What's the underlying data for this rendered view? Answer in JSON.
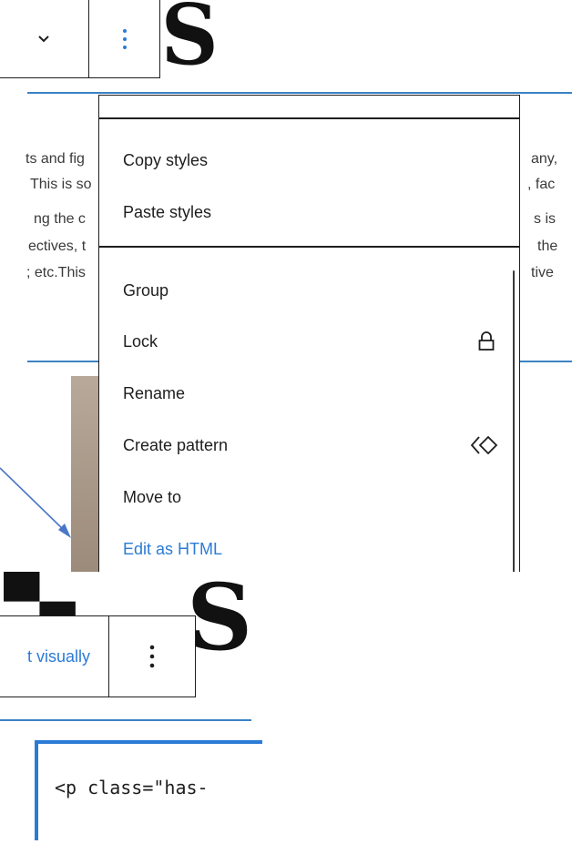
{
  "top": {
    "heading_glyph": "S",
    "paragraph_fragments": [
      {
        "left": "ts and fig",
        "right": "any,"
      },
      {
        "left": "This is so",
        "right": ", fac"
      },
      {
        "left": "ng the c",
        "right": "s is"
      },
      {
        "left": "ectives, t",
        "right": "the"
      },
      {
        "left": "; etc.This",
        "right": "tive"
      }
    ],
    "block_toolbar": {
      "chevron_icon": "chevron-down-icon",
      "more_icon": "more-vertical-icon"
    }
  },
  "menu": {
    "items": [
      {
        "label": "Copy styles"
      },
      {
        "label": "Paste styles"
      },
      {
        "label": "Group"
      },
      {
        "label": "Lock",
        "icon": "lock-icon"
      },
      {
        "label": "Rename"
      },
      {
        "label": "Create pattern",
        "icon": "symbol-diamond-icon"
      },
      {
        "label": "Move to"
      },
      {
        "label": "Edit as HTML"
      }
    ]
  },
  "bottom": {
    "heading_glyphs": "S",
    "edit_visually_label": "t visually",
    "code_line": "<p class=\"has-"
  },
  "colors": {
    "accent": "#2b7bd6",
    "rule_blue": "#3b82c4",
    "text": "#1e1e1e"
  }
}
